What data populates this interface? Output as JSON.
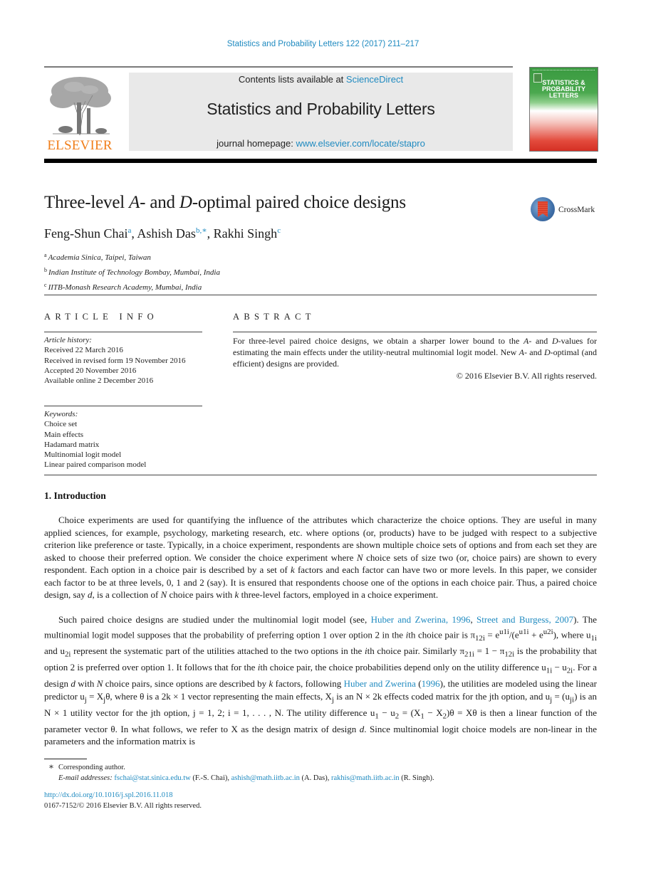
{
  "citation": "Statistics and Probability Letters 122 (2017) 211–217",
  "masthead": {
    "contents_prefix": "Contents lists available at ",
    "contents_link": "ScienceDirect",
    "journal_name": "Statistics and Probability Letters",
    "homepage_prefix": "journal homepage: ",
    "homepage_link": "www.elsevier.com/locate/stapro"
  },
  "publisher_logo": {
    "wordmark": "ELSEVIER",
    "color": "#f07e1a"
  },
  "cover": {
    "title_line1": "STATISTICS &",
    "title_line2": "PROBABILITY",
    "title_line3": "LETTERS"
  },
  "crossmark_label": "CrossMark",
  "article": {
    "title_part1": "Three-level ",
    "title_A": "A",
    "title_part2": "- and ",
    "title_D": "D",
    "title_part3": "-optimal paired choice designs",
    "authors": [
      {
        "name": "Feng-Shun Chai",
        "sup": "a",
        "sep": ", "
      },
      {
        "name": "Ashish Das",
        "sup": "b,∗",
        "sep": ", "
      },
      {
        "name": "Rakhi Singh",
        "sup": "c",
        "sep": ""
      }
    ],
    "affiliations": [
      {
        "sup": "a",
        "text": "Academia Sinica, Taipei, Taiwan"
      },
      {
        "sup": "b",
        "text": "Indian Institute of Technology Bombay, Mumbai, India"
      },
      {
        "sup": "c",
        "text": "IITB-Monash Research Academy, Mumbai, India"
      }
    ]
  },
  "article_info": {
    "heading": "ARTICLE INFO",
    "history_label": "Article history:",
    "history": [
      "Received 22 March 2016",
      "Received in revised form 19 November 2016",
      "Accepted 20 November 2016",
      "Available online 2 December 2016"
    ],
    "keywords_label": "Keywords:",
    "keywords": [
      "Choice set",
      "Main effects",
      "Hadamard matrix",
      "Multinomial logit model",
      "Linear paired comparison model"
    ]
  },
  "abstract": {
    "heading": "ABSTRACT",
    "s1": "For three-level paired choice designs, we obtain a sharper lower bound to the ",
    "A1": "A",
    "s2": "- and ",
    "D1": "D",
    "s3": "-values for estimating the main effects under the utility-neutral multinomial logit model. New ",
    "A2": "A",
    "s4": "- and ",
    "D2": "D",
    "s5": "-optimal (and efficient) designs are provided.",
    "copyright": "© 2016 Elsevier B.V. All rights reserved."
  },
  "introduction": {
    "heading": "1.  Introduction",
    "p1": {
      "a": "Choice experiments are used for quantifying the influence of the attributes which characterize the choice options. They are useful in many applied sciences, for example, psychology, marketing research, etc. where options (or, products) have to be judged with respect to a subjective criterion like preference or taste. Typically, in a choice experiment, respondents are shown multiple choice sets of options and from each set they are asked to choose their preferred option. We consider the choice experiment where ",
      "N1": "N",
      "b": " choice sets of size two (or, choice pairs) are shown to every respondent. Each option in a choice pair is described by a set of ",
      "k1": "k",
      "c": " factors and each factor can have two or more levels. In this paper, we consider each factor to be at three levels, 0, 1 and 2 (say). It is ensured that respondents choose one of the options in each choice pair. Thus, a paired choice design, say ",
      "d1": "d",
      "e": ", is a collection of ",
      "N2": "N",
      "f": " choice pairs with ",
      "k2": "k",
      "g": " three-level factors, employed in a choice experiment."
    },
    "p2": {
      "a": "Such paired choice designs are studied under the multinomial logit model (see, ",
      "ref1": "Huber and Zwerina, 1996",
      "sep1": ", ",
      "ref2": "Street and Burgess, 2007",
      "b": "). The multinomial logit model supposes that the probability of preferring option 1 over option 2 in the ",
      "i1": "i",
      "c": "th choice pair is π",
      "c_sub": "12i",
      "c2": " = e",
      "c_sup1": "u1i",
      "c3": "/(e",
      "c_sup2": "u1i",
      "c4": " + e",
      "c_sup3": "u2i",
      "c5": "), where u",
      "c_sub2": "1i",
      "c6": " and u",
      "c_sub3": "2i",
      "d": " represent the systematic part of the utilities attached to the two options in the ",
      "i2": "i",
      "e": "th choice pair. Similarly π",
      "e_sub": "21i",
      "e2": " = 1 − π",
      "e_sub2": "12i",
      "f": " is the probability that option 2 is preferred over option 1. It follows that for the ",
      "i3": "i",
      "g": "th choice pair, the choice probabilities depend only on the utility difference u",
      "g_sub1": "1i",
      "g2": " − u",
      "g_sub2": "2i",
      "h": ". For a design ",
      "d1": "d",
      "h2": " with ",
      "N1": "N",
      "j": " choice pairs, since options are described by ",
      "k1": "k",
      "k": " factors, following ",
      "ref3": "Huber and Zwerina",
      "l": " (",
      "ref4": "1996",
      "m": "), the utilities are modeled using the linear predictor u",
      "m_sub1": "j",
      "m2": " = X",
      "m_sub2": "j",
      "m3": "θ, where θ is a 2k × 1 vector representing the main effects, X",
      "m_sub3": "j",
      "n": " is an N × 2k effects coded matrix for the jth option, and u",
      "n_sub1": "j",
      "n2": " = (u",
      "n_sub2": "ji",
      "o": ") is an N × 1 utility vector for the jth option, j = 1, 2;  i = 1, . . . , N. The utility difference u",
      "o_sub1": "1",
      "o2": " − u",
      "o_sub2": "2",
      "o3": " = (X",
      "o_sub3": "1",
      "o4": " − X",
      "o_sub4": "2",
      "p": ")θ = Xθ is then a linear function of the parameter vector θ. In what follows, we refer to X as the design matrix of design ",
      "d2": "d",
      "q": ". Since multinomial logit choice models are non-linear in the parameters and the information matrix is"
    }
  },
  "footnotes": {
    "star": "∗",
    "corresponding": "Corresponding author.",
    "email_label": "E-mail addresses:",
    "emails": [
      {
        "address": "fschai@stat.sinica.edu.tw",
        "who": " (F.-S. Chai), "
      },
      {
        "address": "ashish@math.iitb.ac.in",
        "who": " (A. Das), "
      },
      {
        "address": "rakhis@math.iitb.ac.in",
        "who": " (R. Singh)."
      }
    ],
    "doi": "http://dx.doi.org/10.1016/j.spl.2016.11.018",
    "issn": "0167-7152/© 2016 Elsevier B.V. All rights reserved."
  }
}
